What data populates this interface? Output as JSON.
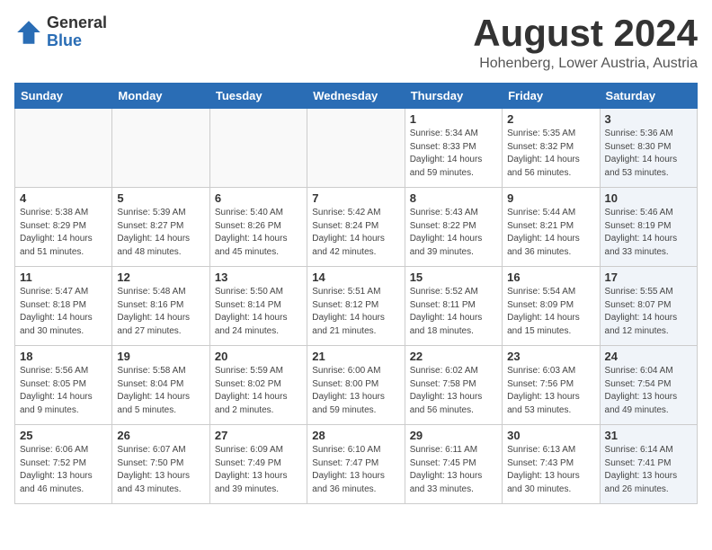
{
  "header": {
    "logo_general": "General",
    "logo_blue": "Blue",
    "title": "August 2024",
    "subtitle": "Hohenberg, Lower Austria, Austria"
  },
  "days_of_week": [
    "Sunday",
    "Monday",
    "Tuesday",
    "Wednesday",
    "Thursday",
    "Friday",
    "Saturday"
  ],
  "weeks": [
    [
      {
        "day": "",
        "info": "",
        "shade": false
      },
      {
        "day": "",
        "info": "",
        "shade": false
      },
      {
        "day": "",
        "info": "",
        "shade": false
      },
      {
        "day": "",
        "info": "",
        "shade": false
      },
      {
        "day": "1",
        "info": "Sunrise: 5:34 AM\nSunset: 8:33 PM\nDaylight: 14 hours\nand 59 minutes.",
        "shade": false
      },
      {
        "day": "2",
        "info": "Sunrise: 5:35 AM\nSunset: 8:32 PM\nDaylight: 14 hours\nand 56 minutes.",
        "shade": false
      },
      {
        "day": "3",
        "info": "Sunrise: 5:36 AM\nSunset: 8:30 PM\nDaylight: 14 hours\nand 53 minutes.",
        "shade": true
      }
    ],
    [
      {
        "day": "4",
        "info": "Sunrise: 5:38 AM\nSunset: 8:29 PM\nDaylight: 14 hours\nand 51 minutes.",
        "shade": false
      },
      {
        "day": "5",
        "info": "Sunrise: 5:39 AM\nSunset: 8:27 PM\nDaylight: 14 hours\nand 48 minutes.",
        "shade": false
      },
      {
        "day": "6",
        "info": "Sunrise: 5:40 AM\nSunset: 8:26 PM\nDaylight: 14 hours\nand 45 minutes.",
        "shade": false
      },
      {
        "day": "7",
        "info": "Sunrise: 5:42 AM\nSunset: 8:24 PM\nDaylight: 14 hours\nand 42 minutes.",
        "shade": false
      },
      {
        "day": "8",
        "info": "Sunrise: 5:43 AM\nSunset: 8:22 PM\nDaylight: 14 hours\nand 39 minutes.",
        "shade": false
      },
      {
        "day": "9",
        "info": "Sunrise: 5:44 AM\nSunset: 8:21 PM\nDaylight: 14 hours\nand 36 minutes.",
        "shade": false
      },
      {
        "day": "10",
        "info": "Sunrise: 5:46 AM\nSunset: 8:19 PM\nDaylight: 14 hours\nand 33 minutes.",
        "shade": true
      }
    ],
    [
      {
        "day": "11",
        "info": "Sunrise: 5:47 AM\nSunset: 8:18 PM\nDaylight: 14 hours\nand 30 minutes.",
        "shade": false
      },
      {
        "day": "12",
        "info": "Sunrise: 5:48 AM\nSunset: 8:16 PM\nDaylight: 14 hours\nand 27 minutes.",
        "shade": false
      },
      {
        "day": "13",
        "info": "Sunrise: 5:50 AM\nSunset: 8:14 PM\nDaylight: 14 hours\nand 24 minutes.",
        "shade": false
      },
      {
        "day": "14",
        "info": "Sunrise: 5:51 AM\nSunset: 8:12 PM\nDaylight: 14 hours\nand 21 minutes.",
        "shade": false
      },
      {
        "day": "15",
        "info": "Sunrise: 5:52 AM\nSunset: 8:11 PM\nDaylight: 14 hours\nand 18 minutes.",
        "shade": false
      },
      {
        "day": "16",
        "info": "Sunrise: 5:54 AM\nSunset: 8:09 PM\nDaylight: 14 hours\nand 15 minutes.",
        "shade": false
      },
      {
        "day": "17",
        "info": "Sunrise: 5:55 AM\nSunset: 8:07 PM\nDaylight: 14 hours\nand 12 minutes.",
        "shade": true
      }
    ],
    [
      {
        "day": "18",
        "info": "Sunrise: 5:56 AM\nSunset: 8:05 PM\nDaylight: 14 hours\nand 9 minutes.",
        "shade": false
      },
      {
        "day": "19",
        "info": "Sunrise: 5:58 AM\nSunset: 8:04 PM\nDaylight: 14 hours\nand 5 minutes.",
        "shade": false
      },
      {
        "day": "20",
        "info": "Sunrise: 5:59 AM\nSunset: 8:02 PM\nDaylight: 14 hours\nand 2 minutes.",
        "shade": false
      },
      {
        "day": "21",
        "info": "Sunrise: 6:00 AM\nSunset: 8:00 PM\nDaylight: 13 hours\nand 59 minutes.",
        "shade": false
      },
      {
        "day": "22",
        "info": "Sunrise: 6:02 AM\nSunset: 7:58 PM\nDaylight: 13 hours\nand 56 minutes.",
        "shade": false
      },
      {
        "day": "23",
        "info": "Sunrise: 6:03 AM\nSunset: 7:56 PM\nDaylight: 13 hours\nand 53 minutes.",
        "shade": false
      },
      {
        "day": "24",
        "info": "Sunrise: 6:04 AM\nSunset: 7:54 PM\nDaylight: 13 hours\nand 49 minutes.",
        "shade": true
      }
    ],
    [
      {
        "day": "25",
        "info": "Sunrise: 6:06 AM\nSunset: 7:52 PM\nDaylight: 13 hours\nand 46 minutes.",
        "shade": false
      },
      {
        "day": "26",
        "info": "Sunrise: 6:07 AM\nSunset: 7:50 PM\nDaylight: 13 hours\nand 43 minutes.",
        "shade": false
      },
      {
        "day": "27",
        "info": "Sunrise: 6:09 AM\nSunset: 7:49 PM\nDaylight: 13 hours\nand 39 minutes.",
        "shade": false
      },
      {
        "day": "28",
        "info": "Sunrise: 6:10 AM\nSunset: 7:47 PM\nDaylight: 13 hours\nand 36 minutes.",
        "shade": false
      },
      {
        "day": "29",
        "info": "Sunrise: 6:11 AM\nSunset: 7:45 PM\nDaylight: 13 hours\nand 33 minutes.",
        "shade": false
      },
      {
        "day": "30",
        "info": "Sunrise: 6:13 AM\nSunset: 7:43 PM\nDaylight: 13 hours\nand 30 minutes.",
        "shade": false
      },
      {
        "day": "31",
        "info": "Sunrise: 6:14 AM\nSunset: 7:41 PM\nDaylight: 13 hours\nand 26 minutes.",
        "shade": true
      }
    ]
  ]
}
